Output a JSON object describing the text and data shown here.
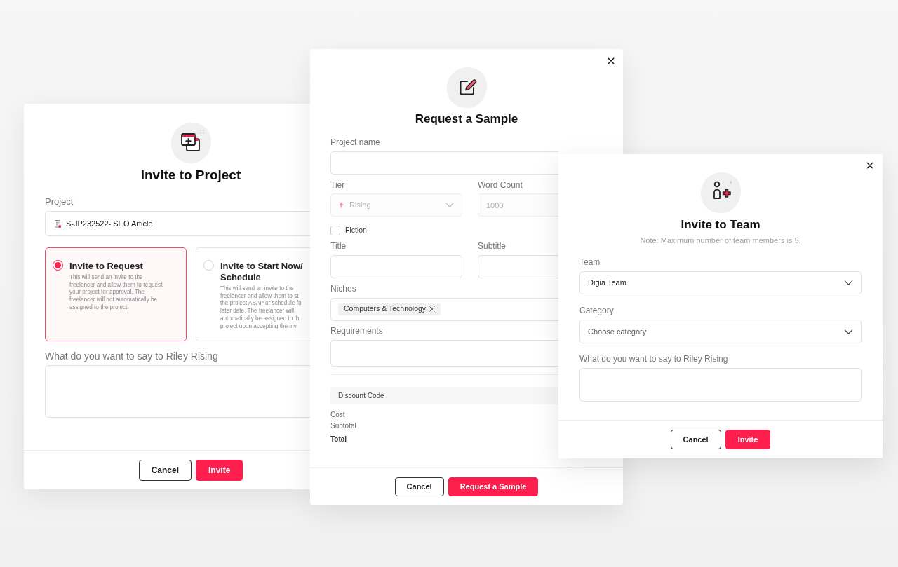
{
  "invite_to_project": {
    "title": "Invite to Project",
    "project": {
      "label": "Project",
      "value": "S-JP232522- SEO Article"
    },
    "options": [
      {
        "title": "Invite to Request",
        "description": "This will send an invite to the\nfreelancer and allow them to request\nyour project for approval. The\nfreelancer will not automatically be\nassigned to the project.",
        "selected": true
      },
      {
        "title": "Invite to Start Now/ Schedule",
        "description": "This will send an invite to the\nfreelancer and allow them to st\nthe project ASAP or schedule fo\nlater date. The freelancer will\nautomatically be assigned to th\nproject upon accepting the invi",
        "selected": false
      }
    ],
    "message": {
      "label": "What do you want to say to Riley Rising"
    },
    "buttons": [
      {
        "label": "Cancel",
        "kind": "secondary"
      },
      {
        "label": "Invite",
        "kind": "primary"
      }
    ]
  },
  "request_a_sample": {
    "title": "Request a Sample",
    "project_name": {
      "label": "Project name"
    },
    "tier": {
      "label": "Tier",
      "value": "Rising",
      "disabled": true
    },
    "word_count": {
      "label": "Word Count",
      "value": "1000",
      "disabled": true
    },
    "fiction": {
      "label": "Fiction",
      "checked": false
    },
    "title_field": {
      "label": "Title"
    },
    "subtitle_field": {
      "label": "Subtitle"
    },
    "niches": {
      "label": "Niches",
      "tags": [
        "Computers & Technology"
      ]
    },
    "requirements": {
      "label": "Requirements"
    },
    "discount_code": {
      "label": "Discount Code"
    },
    "summary": [
      {
        "label": "Cost",
        "kind": "line"
      },
      {
        "label": "Subtotal",
        "kind": "line"
      },
      {
        "label": "Total",
        "kind": "total"
      }
    ],
    "buttons": [
      {
        "label": "Cancel",
        "kind": "secondary"
      },
      {
        "label": "Request a Sample",
        "kind": "primary"
      }
    ]
  },
  "invite_to_team": {
    "title": "Invite to Team",
    "note": "Note: Maximum number of team members is 5.",
    "team": {
      "label": "Team",
      "value": "Digia Team"
    },
    "category": {
      "label": "Category",
      "placeholder": "Choose category"
    },
    "message": {
      "label": "What do you want to say to Riley Rising"
    },
    "buttons": [
      {
        "label": "Cancel",
        "kind": "secondary"
      },
      {
        "label": "Invite",
        "kind": "primary"
      }
    ]
  }
}
